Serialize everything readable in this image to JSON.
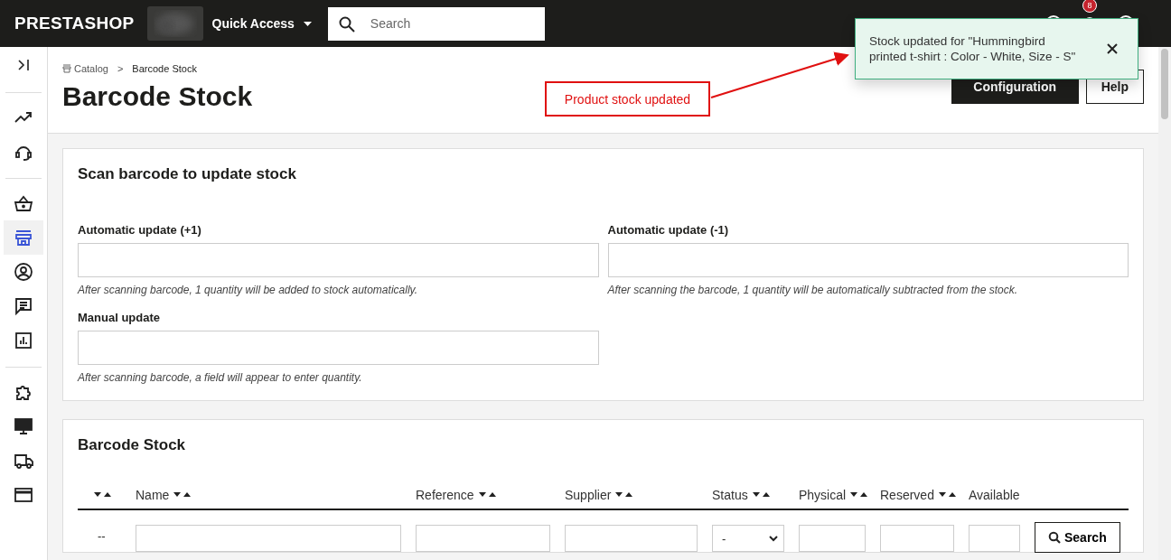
{
  "topbar": {
    "logo": "PRESTASHOP",
    "quick_access": "Quick Access",
    "search": {
      "placeholder": "Search"
    },
    "notifications_count": "8"
  },
  "sidebar": {
    "groups": [
      [
        {
          "kind": "trend",
          "selected": false
        },
        {
          "kind": "headset",
          "selected": false
        }
      ],
      [
        {
          "kind": "basket",
          "selected": false
        },
        {
          "kind": "store",
          "selected": true
        },
        {
          "kind": "user",
          "selected": false
        },
        {
          "kind": "chat",
          "selected": false
        },
        {
          "kind": "stats",
          "selected": false
        }
      ],
      [
        {
          "kind": "puzzle",
          "selected": false
        },
        {
          "kind": "monitor",
          "selected": false
        },
        {
          "kind": "truck",
          "selected": false
        },
        {
          "kind": "card",
          "selected": false
        }
      ]
    ]
  },
  "breadcrumb": {
    "parent": "Catalog",
    "separator": ">",
    "current": "Barcode Stock"
  },
  "title": "Barcode Stock",
  "header_buttons": [
    {
      "label": "Configuration",
      "kind": "primary"
    },
    {
      "label": "Help",
      "kind": "outline"
    }
  ],
  "toast": {
    "message": "Stock updated for \"Hummingbird printed t-shirt : Color - White, Size - S\""
  },
  "annotation": {
    "label": "Product stock updated"
  },
  "scan_card": {
    "title": "Scan barcode to update stock",
    "fields": [
      {
        "label": "Automatic update (+1)",
        "help": "After scanning barcode, 1 quantity will be added to stock automatically."
      },
      {
        "label": "Automatic update (-1)",
        "help": "After scanning the barcode, 1 quantity will be automatically subtracted from the stock."
      },
      {
        "label": "Manual update",
        "help": "After scanning barcode, a field will appear to enter quantity."
      }
    ]
  },
  "table_card": {
    "title": "Barcode Stock",
    "columns": [
      {
        "sortable": true
      },
      {
        "label": "Name",
        "sortable": true
      },
      {
        "label": "Reference",
        "sortable": true
      },
      {
        "label": "Supplier",
        "sortable": true
      },
      {
        "label": "Status",
        "sortable": true
      },
      {
        "label": "Physical",
        "sortable": true
      },
      {
        "label": "Reserved",
        "sortable": true
      },
      {
        "label": "Available",
        "sortable": false
      }
    ],
    "filter": {
      "id_text": "--",
      "status_value": "-",
      "search_button": "Search"
    }
  }
}
